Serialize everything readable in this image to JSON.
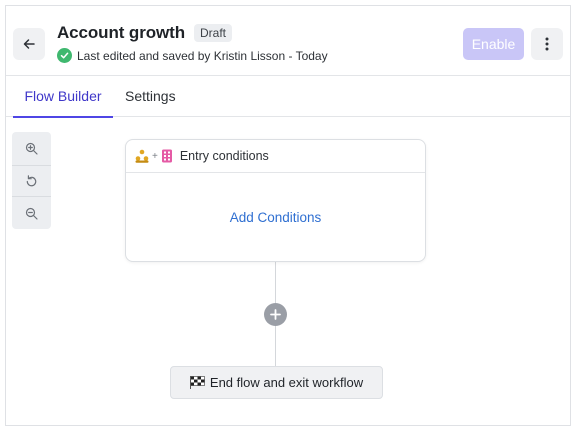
{
  "header": {
    "title": "Account growth",
    "badge": "Draft",
    "status_text": "Last edited and saved by Kristin Lisson - Today",
    "enable_label": "Enable"
  },
  "tabs": [
    {
      "label": "Flow Builder",
      "active": true
    },
    {
      "label": "Settings",
      "active": false
    }
  ],
  "zoom_controls": [
    "zoom-in-icon",
    "reset-icon",
    "zoom-out-icon"
  ],
  "entry": {
    "title": "Entry conditions",
    "action_label": "Add Conditions",
    "icons": [
      "people-icon",
      "building-icon"
    ]
  },
  "end": {
    "label": "End flow and exit workflow",
    "icon": "checkered-flag-icon"
  },
  "colors": {
    "accent": "#4f46e5",
    "enable_disabled": "#c9c6f7",
    "link": "#2f6fd1",
    "success": "#3fb86f"
  }
}
